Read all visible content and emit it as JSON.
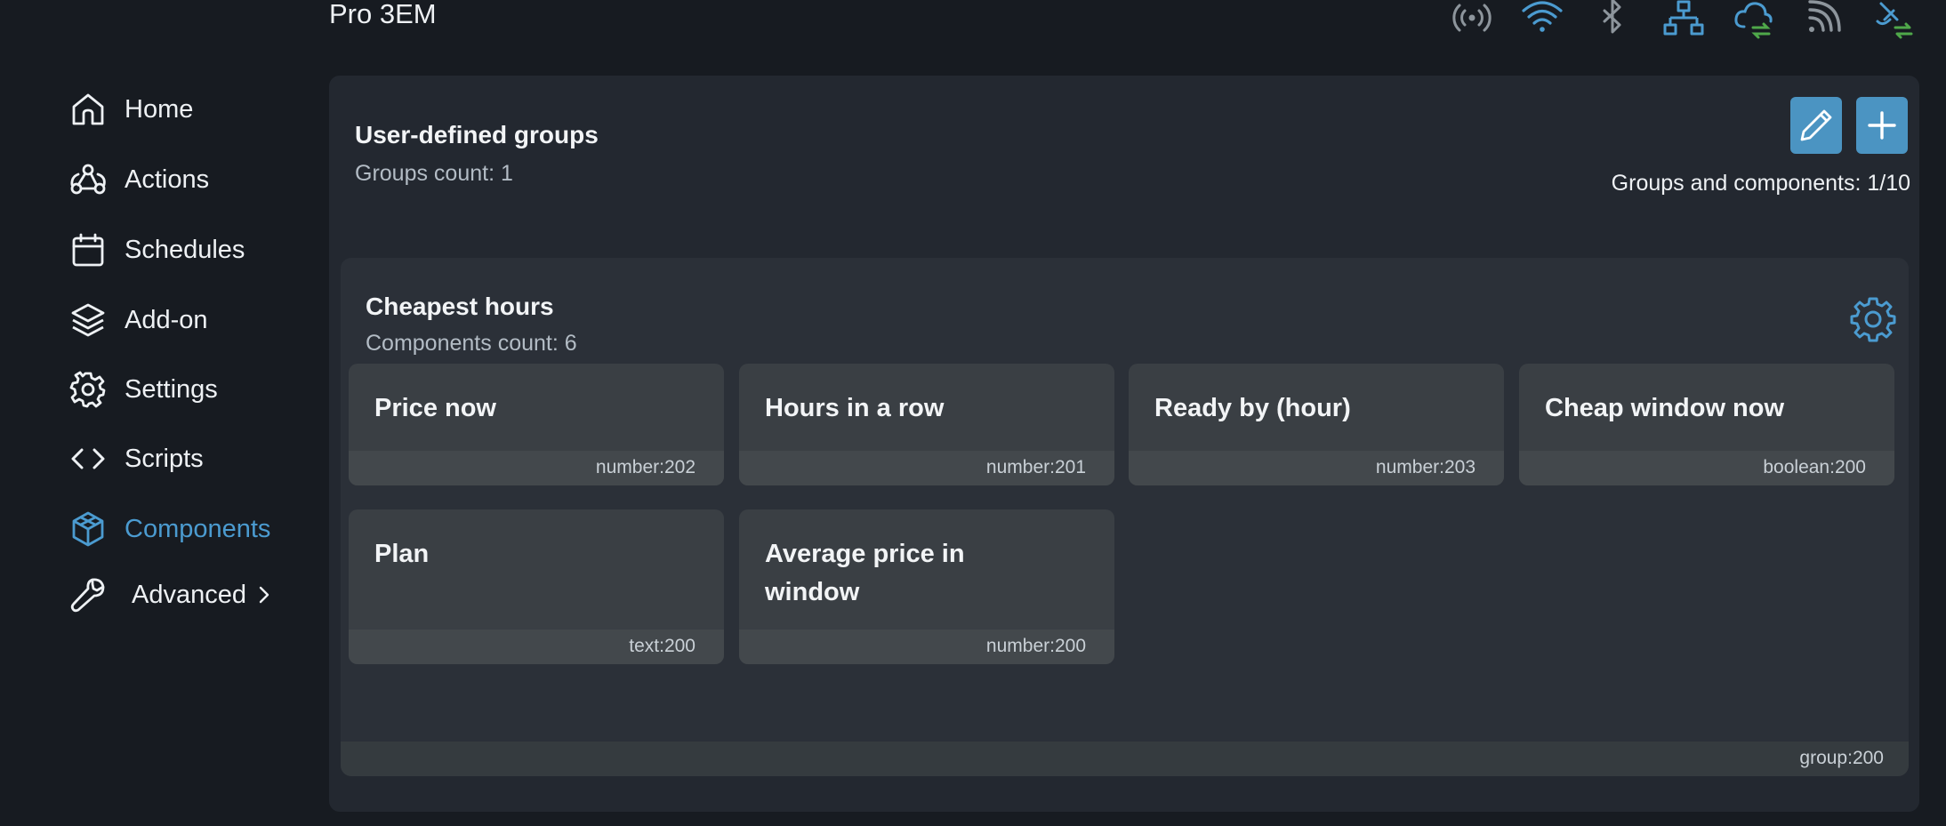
{
  "header": {
    "device_name": "Pro 3EM",
    "status_icons": [
      "broadcast-icon",
      "wifi-icon",
      "bluetooth-icon",
      "ethernet-icon",
      "cloud-sync-icon",
      "rss-icon",
      "satellite-sync-icon"
    ]
  },
  "sidebar": {
    "items": [
      {
        "label": "Home",
        "icon": "home-icon"
      },
      {
        "label": "Actions",
        "icon": "webhook-icon"
      },
      {
        "label": "Schedules",
        "icon": "calendar-icon"
      },
      {
        "label": "Add-on",
        "icon": "layers-icon"
      },
      {
        "label": "Settings",
        "icon": "gear-icon"
      },
      {
        "label": "Scripts",
        "icon": "code-icon"
      },
      {
        "label": "Components",
        "icon": "cube-icon",
        "active": true
      },
      {
        "label": "Advanced",
        "icon": "wrench-icon",
        "has_submenu": true
      }
    ]
  },
  "panel": {
    "title": "User-defined groups",
    "subtitle": "Groups count: 1",
    "counter": "Groups and components: 1/10"
  },
  "group": {
    "title": "Cheapest hours",
    "subtitle": "Components count: 6",
    "tag": "group:200",
    "components": [
      {
        "name": "Price now",
        "tag": "number:202"
      },
      {
        "name": "Hours in a row",
        "tag": "number:201"
      },
      {
        "name": "Ready by (hour)",
        "tag": "number:203"
      },
      {
        "name": "Cheap window now",
        "tag": "boolean:200"
      },
      {
        "name": "Plan",
        "tag": "text:200"
      },
      {
        "name": "Average price in window",
        "tag": "number:200"
      }
    ]
  },
  "colors": {
    "accent": "#4b9bd0",
    "button": "#4b94c2",
    "sync_green": "#4fa84a"
  }
}
